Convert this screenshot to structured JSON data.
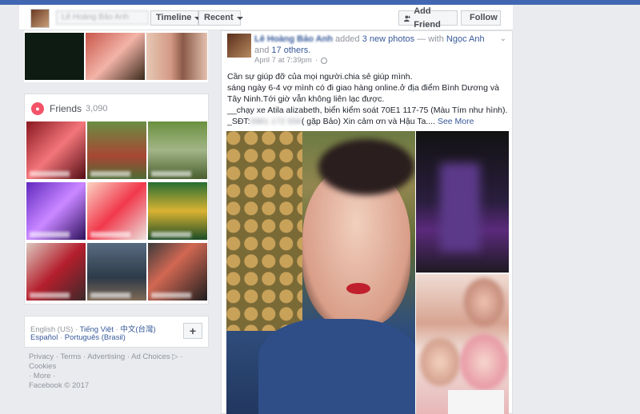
{
  "header": {
    "profile_name": "Lê Hoàng Bảo Anh",
    "timeline_label": "Timeline",
    "recent_label": "Recent",
    "add_friend_label": "Add Friend",
    "follow_label": "Follow"
  },
  "friends": {
    "title": "Friends",
    "count": "3,090",
    "icon": "friends-icon"
  },
  "languages": {
    "line1": [
      "English (US)",
      "Tiếng Việt",
      "中文(台灣)"
    ],
    "line2": [
      "Español",
      "Português (Brasil)"
    ],
    "sep": " · ",
    "plus": "+"
  },
  "footer": {
    "line1": "Privacy · Terms · Advertising · Ad Choices ▷ · Cookies",
    "line2": "· More ·",
    "line3": "Facebook © 2017"
  },
  "post": {
    "author": "Lê Hoàng Bảo Anh",
    "action_pre": "added",
    "photos": "3 new photos",
    "with_text": "— with",
    "tag1": "Ngọc Anh",
    "and_text": "and",
    "others": "17 others.",
    "time": "April 7 at 7:39pm",
    "sep": "·",
    "line1": "Cần sự giúp đỡ của mọi người.chia sẻ giúp mình.",
    "line2": "sáng ngày 6-4 vợ mình có đi giao hàng online.ở địa điểm Bình Dương và",
    "line3": "Tây Ninh.Tới giờ vẫn không liên lạc được.",
    "line4": "__chạy xe Atila alizabeth, biển kiểm soát 70E1 117-75 (Màu Tím như hình).",
    "line5_pre": "_SĐT:",
    "line5_phone": "0981 172 556",
    "line5_post": "( gặp Bảo) Xin cảm ơn và Hậu Ta....",
    "see_more": "See More"
  },
  "colors": {
    "fb_blue": "#4267b2",
    "link": "#365899",
    "page_bg": "#e9ebee"
  }
}
